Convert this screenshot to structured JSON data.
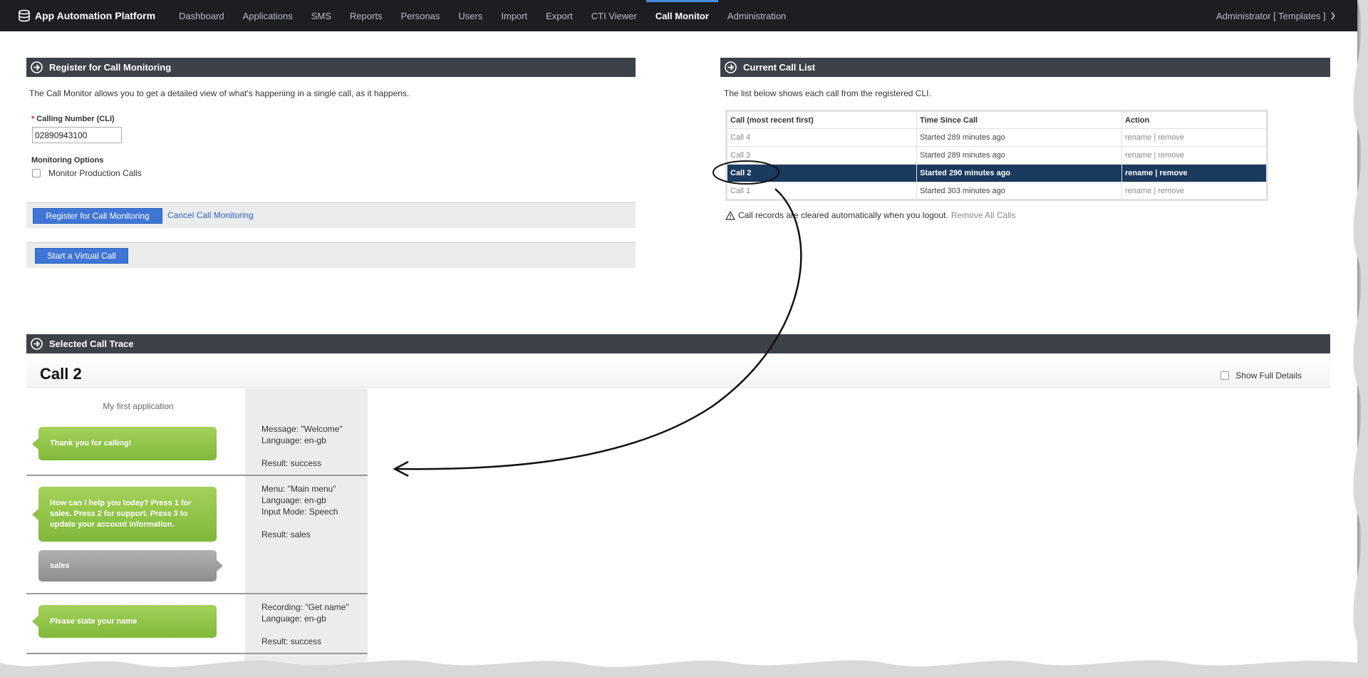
{
  "nav": {
    "brand": "App Automation Platform",
    "items": [
      {
        "label": "Dashboard",
        "active": false
      },
      {
        "label": "Applications",
        "active": false
      },
      {
        "label": "SMS",
        "active": false
      },
      {
        "label": "Reports",
        "active": false
      },
      {
        "label": "Personas",
        "active": false
      },
      {
        "label": "Users",
        "active": false
      },
      {
        "label": "Import",
        "active": false
      },
      {
        "label": "Export",
        "active": false
      },
      {
        "label": "CTI Viewer",
        "active": false
      },
      {
        "label": "Call Monitor",
        "active": true
      },
      {
        "label": "Administration",
        "active": false
      }
    ],
    "user": "Administrator [ Templates ]",
    "icons": {
      "brand": "database-icon",
      "user_menu": "chevron-down-icon"
    }
  },
  "register": {
    "header": "Register for Call Monitoring",
    "description": "The Call Monitor allows you to get a detailed view of what's happening in a single call, as it happens.",
    "cli_label": "Calling Number (CLI)",
    "cli_required_mark": "*",
    "cli_value": "02890943100",
    "options_label": "Monitoring Options",
    "monitor_production_label": "Monitor Production Calls",
    "monitor_production_checked": false,
    "register_button": "Register for Call Monitoring",
    "cancel_link": "Cancel Call Monitoring",
    "virtual_call_button": "Start a Virtual Call"
  },
  "call_list": {
    "header": "Current Call List",
    "description": "The list below shows each call from the registered CLI.",
    "columns": [
      "Call (most recent first)",
      "Time Since Call",
      "Action"
    ],
    "rows": [
      {
        "call": "Call 4",
        "time": "Started 289 minutes ago",
        "action": "rename | remove",
        "selected": false
      },
      {
        "call": "Call 3",
        "time": "Started 289 minutes ago",
        "action": "rename | remove",
        "selected": false
      },
      {
        "call": "Call 2",
        "time": "Started 290 minutes ago",
        "action": "rename | remove",
        "selected": true
      },
      {
        "call": "Call 1",
        "time": "Started 303 minutes ago",
        "action": "rename | remove",
        "selected": false
      }
    ],
    "warning": "Call records are cleared automatically when you logout.",
    "remove_all_link": "Remove All Calls"
  },
  "trace": {
    "header": "Selected Call Trace",
    "call_title": "Call 2",
    "show_full_details_label": "Show Full Details",
    "show_full_details_checked": false,
    "app_name": "My first application",
    "steps": [
      {
        "bubble": "Thank you for calling!",
        "info": [
          "Message: \"Welcome\"",
          "Language: en-gb",
          "",
          "Result: success"
        ]
      },
      {
        "bubble": "How can I help you today? Press 1 for sales. Press 2 for support. Press 3 to update your account information.",
        "response": "sales",
        "info": [
          "Menu: \"Main menu\"",
          "Language: en-gb",
          "Input Mode: Speech",
          "",
          "Result: sales"
        ]
      },
      {
        "bubble": "Please state your name",
        "info": [
          "Recording: \"Get name\"",
          "Language: en-gb",
          "",
          "Result: success"
        ]
      }
    ]
  },
  "colors": {
    "nav_bg": "#1c1e22",
    "panel_header": "#3d4148",
    "primary_button": "#3f76d6",
    "selected_row": "#1a3a5e",
    "prompt_bubble": "#8cc043",
    "response_bubble": "#9e9e9e"
  }
}
